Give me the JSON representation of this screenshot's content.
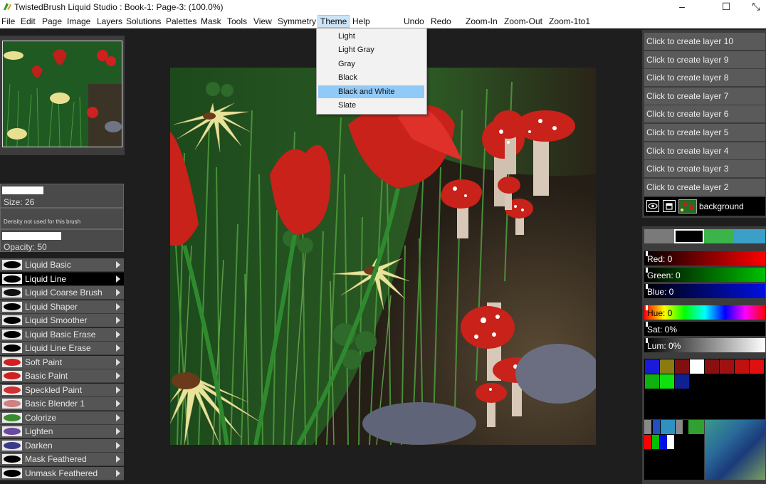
{
  "window": {
    "title": "TwistedBrush Liquid Studio : Book-1: Page-3:  (100.0%)",
    "minimize": "–",
    "maximize": "☐",
    "close": "⤡"
  },
  "menu": {
    "items": [
      "File",
      "Edit",
      "Page",
      "Image",
      "Layers",
      "Solutions",
      "Palettes",
      "Mask",
      "Tools",
      "View",
      "Symmetry",
      "Theme",
      "Help"
    ],
    "actions": [
      "Undo",
      "Redo",
      "Zoom-In",
      "Zoom-Out",
      "Zoom-1to1"
    ],
    "active": "Theme"
  },
  "theme_menu": {
    "options": [
      "Light",
      "Light Gray",
      "Gray",
      "Black",
      "Black and White",
      "Slate"
    ],
    "selected": "Black and White"
  },
  "brush_settings": {
    "size_label": "Size: 26",
    "size_fraction": 0.34,
    "density_note": "Density not used for this brush",
    "opacity_label": "Opacity: 50",
    "opacity_fraction": 0.5
  },
  "brushes": [
    {
      "label": "Liquid Basic",
      "icon": "black-blob-icon"
    },
    {
      "label": "Liquid Line",
      "icon": "black-line-icon",
      "selected": true
    },
    {
      "label": "Liquid Coarse Brush",
      "icon": "coarse-brush-icon"
    },
    {
      "label": "Liquid Shaper",
      "icon": "shaper-icon"
    },
    {
      "label": "Liquid Smoother",
      "icon": "smoother-icon"
    },
    {
      "label": "Liquid Basic Erase",
      "icon": "erase-icon"
    },
    {
      "label": "Liquid Line Erase",
      "icon": "line-erase-icon"
    },
    {
      "label": "Soft Paint",
      "icon": "soft-paint-icon"
    },
    {
      "label": "Basic Paint",
      "icon": "basic-paint-icon"
    },
    {
      "label": "Speckled Paint",
      "icon": "speckled-paint-icon"
    },
    {
      "label": "Basic Blender 1",
      "icon": "blender-icon"
    },
    {
      "label": "Colorize",
      "icon": "colorize-icon"
    },
    {
      "label": "Lighten",
      "icon": "lighten-icon"
    },
    {
      "label": "Darken",
      "icon": "darken-icon"
    },
    {
      "label": "Mask Feathered",
      "icon": "mask-feathered-icon"
    },
    {
      "label": "Unmask Feathered",
      "icon": "unmask-feathered-icon"
    }
  ],
  "layers": {
    "create_buttons": [
      "Click to create layer 10",
      "Click to create layer 9",
      "Click to create layer 8",
      "Click to create layer 7",
      "Click to create layer 6",
      "Click to create layer 5",
      "Click to create layer 4",
      "Click to create layer 3",
      "Click to create layer 2"
    ],
    "background_label": "background"
  },
  "color": {
    "red_label": "Red: 0",
    "green_label": "Green: 0",
    "blue_label": "Blue: 0",
    "hue_label": "Hue: 0",
    "sat_label": "Sat: 0%",
    "lum_label": "Lum: 0%",
    "current": "#000000",
    "recent": [
      "#7a7a7a",
      "#000000",
      "#3cb44a",
      "#3aa0c8"
    ],
    "palette_row1": [
      "#1a1ad8",
      "#8a7a10",
      "#801010",
      "#ffffff",
      "#8a1010",
      "#a01010",
      "#c01010",
      "#e01010"
    ],
    "palette_row2": [
      "#10b010",
      "#10e010",
      "#102090"
    ]
  }
}
